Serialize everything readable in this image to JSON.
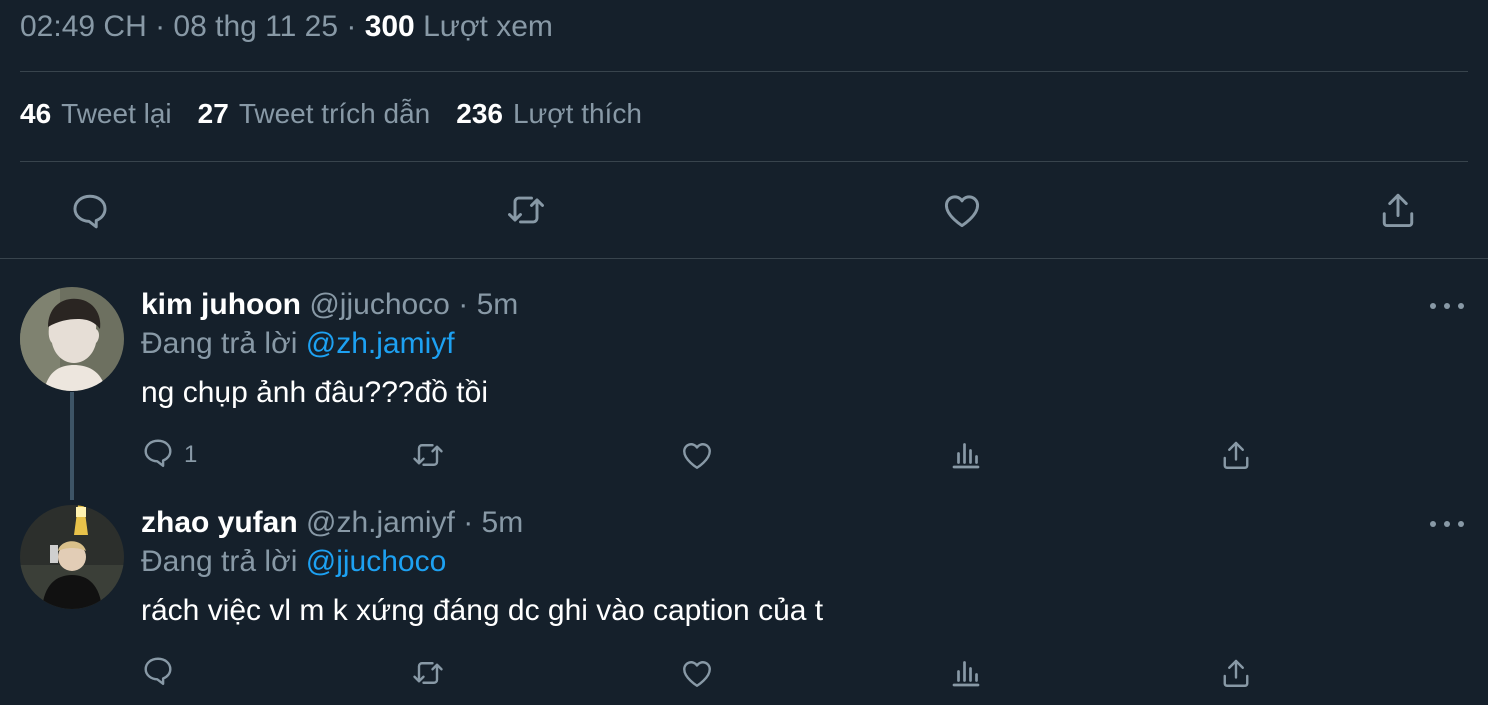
{
  "tweet_meta": {
    "time": "02:49 CH",
    "sep1": " · ",
    "date": "08 thg 11 25",
    "sep2": " · ",
    "views_count": "300",
    "views_label": "Lượt xem"
  },
  "stats": [
    {
      "count": "46",
      "label": "Tweet lại"
    },
    {
      "count": "27",
      "label": "Tweet trích dẫn"
    },
    {
      "count": "236",
      "label": "Lượt thích"
    }
  ],
  "icons": {
    "reply": "reply-icon",
    "retweet": "retweet-icon",
    "like": "heart-icon",
    "share": "share-icon",
    "views": "views-icon",
    "more": "more-icon"
  },
  "replies": [
    {
      "name": "kim juhoon",
      "handle": "@jjuchoco",
      "time": "5m",
      "replying_prefix": "Đang trả lời",
      "replying_to": "@zh.jamiyf",
      "text": "ng chụp ảnh đâu???đồ tồi",
      "reply_count": "1"
    },
    {
      "name": "zhao yufan",
      "handle": "@zh.jamiyf",
      "time": "5m",
      "replying_prefix": "Đang trả lời",
      "replying_to": "@jjuchoco",
      "text": "rách việc vl m k xứng đáng dc ghi vào caption của t",
      "reply_count": ""
    }
  ],
  "colors": {
    "background": "#15202b",
    "muted": "#8899a6",
    "accent": "#1da1f2",
    "divider": "#38444d"
  }
}
